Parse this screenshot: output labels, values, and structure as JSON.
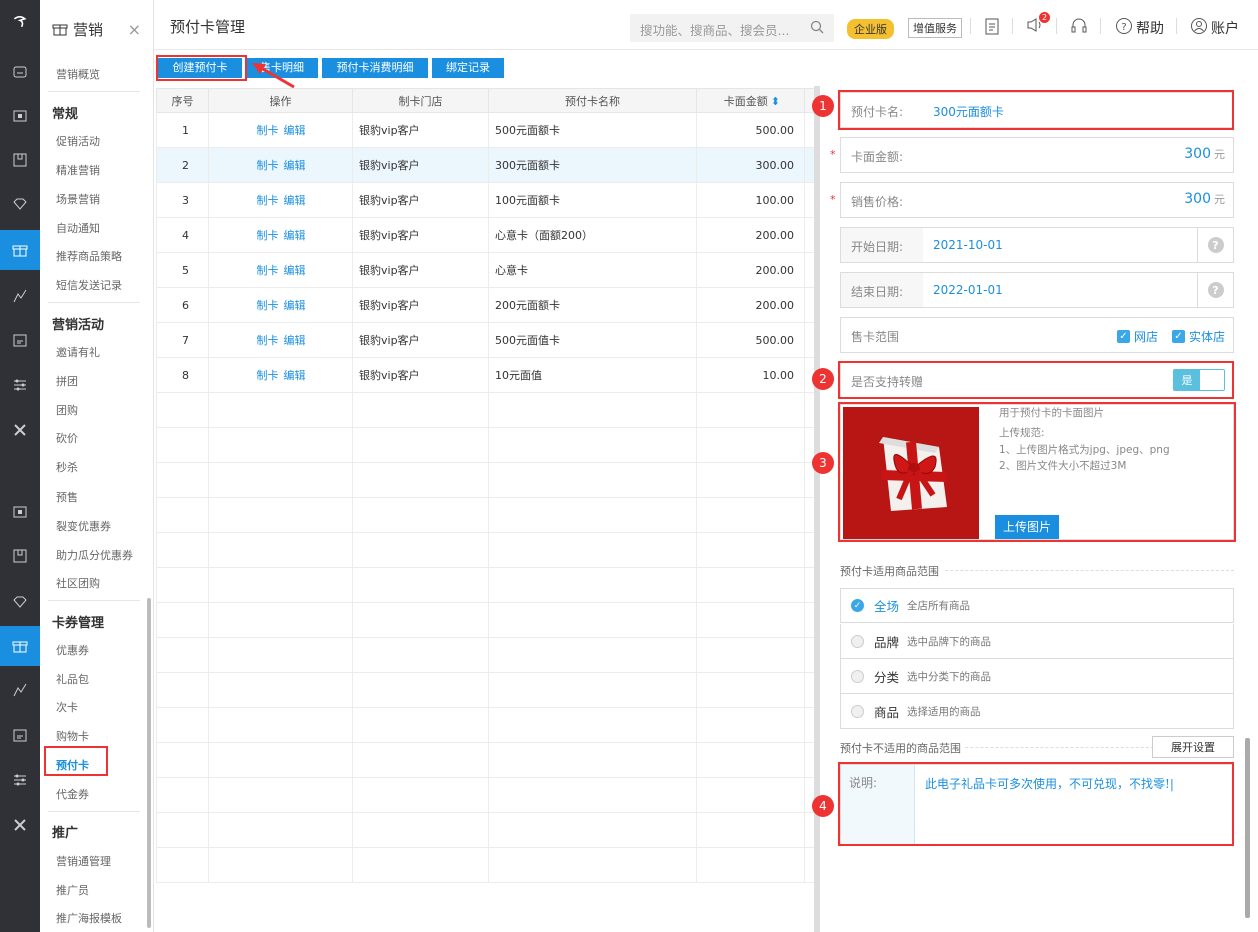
{
  "app": {
    "logo": "logo-icon"
  },
  "topbar": {
    "page_title": "预付卡管理",
    "search_placeholder": "搜功能、搜商品、搜会员...",
    "edition_badge": "企业版",
    "value_service": "增值服务",
    "notify_count": "2",
    "help": "帮助",
    "account": "账户"
  },
  "sidebar": {
    "title": "营销",
    "overview": "营销概览",
    "sections": [
      {
        "title": "常规",
        "items": [
          "促销活动",
          "精准营销",
          "场景营销",
          "自动通知",
          "推荐商品策略",
          "短信发送记录"
        ]
      },
      {
        "title": "营销活动",
        "items": [
          "邀请有礼",
          "拼团",
          "团购",
          "砍价",
          "秒杀",
          "预售",
          "裂变优惠券",
          "助力瓜分优惠券",
          "社区团购"
        ]
      },
      {
        "title": "卡券管理",
        "items": [
          "优惠券",
          "礼品包",
          "次卡",
          "购物卡",
          "预付卡",
          "代金券"
        ]
      },
      {
        "title": "推广",
        "items": [
          "营销通管理",
          "推广员",
          "推广海报模板"
        ]
      }
    ],
    "selected": "预付卡"
  },
  "toolbar": {
    "buttons": [
      "创建预付卡",
      "售卡明细",
      "预付卡消费明细",
      "绑定记录"
    ]
  },
  "table": {
    "headers": [
      "序号",
      "操作",
      "制卡门店",
      "预付卡名称",
      "卡面金额"
    ],
    "action_make": "制卡",
    "action_edit": "编辑",
    "rows": [
      {
        "no": "1",
        "store": "银豹vip客户",
        "name": "500元面额卡",
        "amount": "500.00"
      },
      {
        "no": "2",
        "store": "银豹vip客户",
        "name": "300元面额卡",
        "amount": "300.00"
      },
      {
        "no": "3",
        "store": "银豹vip客户",
        "name": "100元面额卡",
        "amount": "100.00"
      },
      {
        "no": "4",
        "store": "银豹vip客户",
        "name": "心意卡（面额200）",
        "amount": "200.00"
      },
      {
        "no": "5",
        "store": "银豹vip客户",
        "name": "心意卡",
        "amount": "200.00"
      },
      {
        "no": "6",
        "store": "银豹vip客户",
        "name": "200元面额卡",
        "amount": "200.00"
      },
      {
        "no": "7",
        "store": "银豹vip客户",
        "name": "500元面值卡",
        "amount": "500.00"
      },
      {
        "no": "8",
        "store": "银豹vip客户",
        "name": "10元面值",
        "amount": "10.00"
      }
    ]
  },
  "form": {
    "card_name_label": "预付卡名:",
    "card_name_value": "300元面额卡",
    "face_label": "卡面金额:",
    "face_value": "300",
    "unit": "元",
    "price_label": "销售价格:",
    "price_value": "300",
    "start_label": "开始日期:",
    "start_value": "2021-10-01",
    "end_label": "结束日期:",
    "end_value": "2022-01-01",
    "scope_label": "售卡范围",
    "scope_online": "网店",
    "scope_store": "实体店",
    "transfer_label": "是否支持转赠",
    "transfer_value": "是",
    "image_hint_title": "用于预付卡的卡面图片",
    "image_rule_title": "上传规范:",
    "image_rule_1": "1、上传图片格式为jpg、jpeg、png",
    "image_rule_2": "2、图片文件大小不超过3M",
    "upload_button": "上传图片",
    "goods_scope_title": "预付卡适用商品范围",
    "goods_options": [
      {
        "label": "全场",
        "desc": "全店所有商品"
      },
      {
        "label": "品牌",
        "desc": "选中品牌下的商品"
      },
      {
        "label": "分类",
        "desc": "选中分类下的商品"
      },
      {
        "label": "商品",
        "desc": "选择适用的商品"
      }
    ],
    "excluded_title": "预付卡不适用的商品范围",
    "expand_button": "展开设置",
    "note_label": "说明:",
    "note_value": "此电子礼品卡可多次使用，不可兑现，不找零!|"
  },
  "annotations": [
    "1",
    "2",
    "3",
    "4"
  ],
  "colors": {
    "accent": "#1a8fe0",
    "highlight": "#e33333",
    "badge": "#f5c030"
  }
}
